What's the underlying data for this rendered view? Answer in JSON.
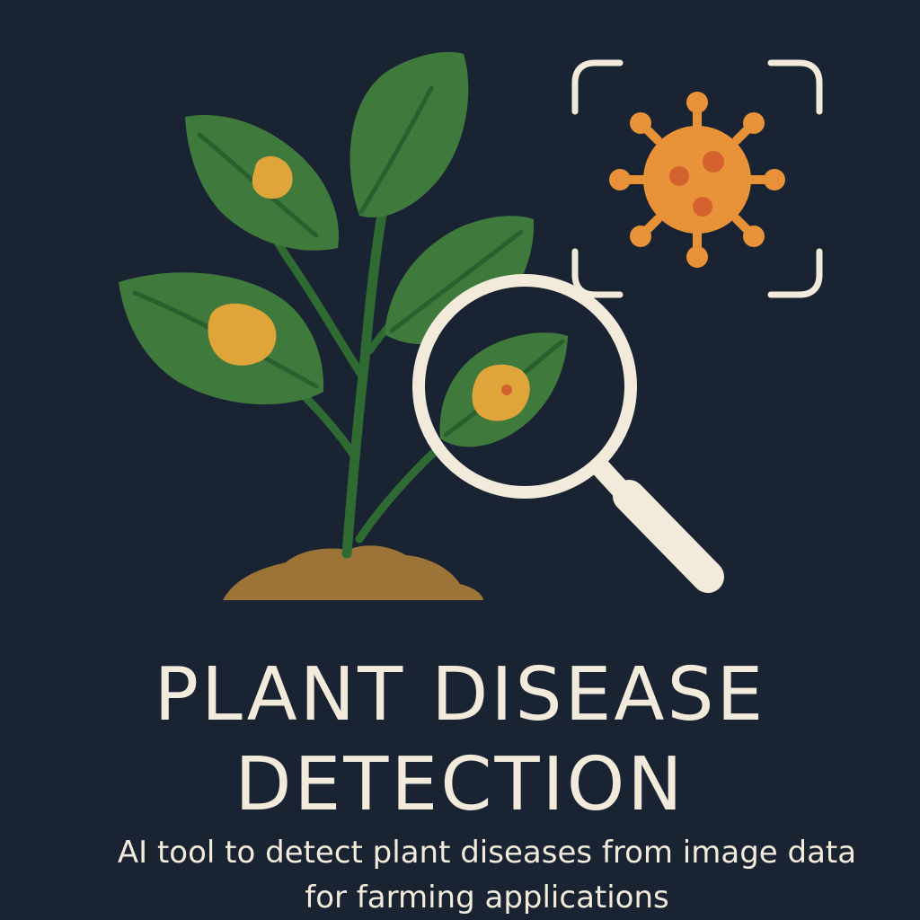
{
  "poster": {
    "title_line_1": "PLANT DISEASE",
    "title_line_2": "DETECTION",
    "subtitle": "AI tool to detect plant diseases from image data for farming applications"
  },
  "colors": {
    "background": "#1a2332",
    "leaf": "#3f7a3c",
    "stem": "#2f6a33",
    "vein": "#2c5f2e",
    "spot": "#e0a53a",
    "soil": "#9c7438",
    "pathogen": "#e8923a",
    "pathogen_dot": "#d4622e",
    "frame": "#f2ebdc"
  },
  "icons": [
    "plant-icon",
    "soil-mound-icon",
    "magnifying-glass-icon",
    "virus-icon",
    "scan-frame-icon"
  ]
}
